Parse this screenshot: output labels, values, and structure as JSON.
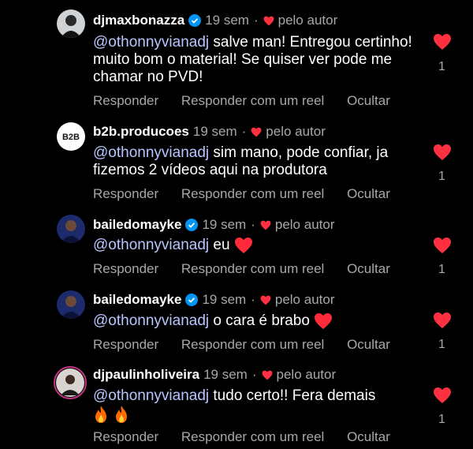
{
  "colors": {
    "accent_heart": "#ff3040",
    "mention": "#b6c6ff",
    "muted": "#a8a8a8",
    "verified": "#0095f6"
  },
  "action_labels": {
    "reply": "Responder",
    "reply_reel": "Responder com um reel",
    "hide": "Ocultar"
  },
  "comments": [
    {
      "username": "djmaxbonazza",
      "verified": true,
      "time": "19 sem",
      "liked_by": "pelo autor",
      "mention": "@othonnyvianadj",
      "text": " salve man! Entregou certinho! muito bom o material! Se quiser ver pode me chamar no PVD!",
      "likes": "1"
    },
    {
      "username": "b2b.producoes",
      "verified": false,
      "time": "19 sem",
      "liked_by": "pelo autor",
      "mention": "@othonnyvianadj",
      "text": " sim mano, pode confiar, ja fizemos 2 vídeos aqui na produtora",
      "likes": "1",
      "avatar_text": "B2B"
    },
    {
      "username": "bailedomayke",
      "verified": true,
      "time": "19 sem",
      "liked_by": "pelo autor",
      "mention": "@othonnyvianadj",
      "text": " eu",
      "emoji": "heart",
      "likes": "1"
    },
    {
      "username": "bailedomayke",
      "verified": true,
      "time": "19 sem",
      "liked_by": "pelo autor",
      "mention": "@othonnyvianadj",
      "text": " o cara é brabo",
      "emoji": "heart",
      "likes": "1"
    },
    {
      "username": "djpaulinholiveira",
      "verified": false,
      "time": "19 sem",
      "liked_by": "pelo autor",
      "mention": "@othonnyvianadj",
      "text": " tudo certo!! Fera demais",
      "emoji": "fire-fire",
      "likes": "1"
    }
  ]
}
